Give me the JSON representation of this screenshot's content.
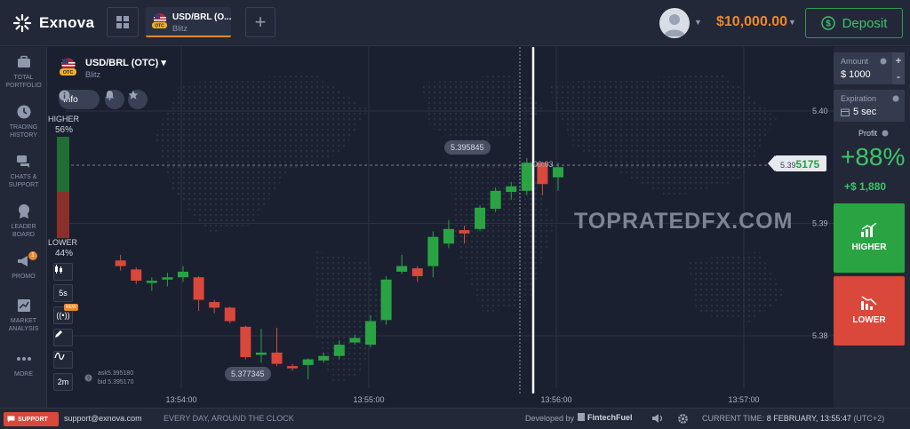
{
  "app": {
    "name": "Exnova"
  },
  "header": {
    "tab": {
      "name": "USD/BRL (O...",
      "sub": "Blitz"
    },
    "balance": "$10,000.00",
    "deposit_label": "Deposit"
  },
  "sidebar": {
    "items": [
      {
        "label": "TOTAL PORTFOLIO",
        "icon": "briefcase-icon"
      },
      {
        "label": "TRADING HISTORY",
        "icon": "clock-icon"
      },
      {
        "label": "CHATS & SUPPORT",
        "icon": "chat-icon"
      },
      {
        "label": "LEADER BOARD",
        "icon": "medal-icon"
      },
      {
        "label": "PROMO",
        "icon": "megaphone-icon",
        "badge": "1"
      },
      {
        "label": "MARKET ANALYSIS",
        "icon": "analysis-icon"
      },
      {
        "label": "MORE",
        "icon": "more-icon"
      }
    ]
  },
  "chart_header": {
    "asset": "USD/BRL (OTC)",
    "type": "Blitz",
    "otc_badge": "OTC",
    "info_label": "Info"
  },
  "sentiment": {
    "higher_label": "HIGHER",
    "higher_pct": "56%",
    "lower_label": "LOWER",
    "lower_pct": "44%"
  },
  "tools": {
    "timeframe": "5s",
    "new_badge": "NEW",
    "interval": "2m"
  },
  "quotes": {
    "ask": "ask5.395180",
    "bid": "bid 5.395170"
  },
  "watermark": "TOPRATEDFX.COM",
  "chart": {
    "high_label": "5.395845",
    "low_label": "5.377345",
    "timer": "00:03",
    "current_price_prefix": "5.39",
    "current_price_suffix": "5175",
    "colors": {
      "up": "#2aa443",
      "down": "#d9483b"
    }
  },
  "chart_data": {
    "type": "candlestick",
    "yticks": [
      5.4,
      5.39,
      5.38
    ],
    "ytick_labels": [
      "5.40",
      "5.39",
      "5.38"
    ],
    "xtick_labels": [
      "13:54:00",
      "13:55:00",
      "13:56:00",
      "13:57:00"
    ],
    "candles": [
      {
        "o": 5.3867,
        "c": 5.3862,
        "h": 5.3872,
        "l": 5.3858
      },
      {
        "o": 5.3859,
        "c": 5.3849,
        "h": 5.3861,
        "l": 5.3846
      },
      {
        "o": 5.3847,
        "c": 5.3849,
        "h": 5.3852,
        "l": 5.384
      },
      {
        "o": 5.385,
        "c": 5.3852,
        "h": 5.3856,
        "l": 5.3844
      },
      {
        "o": 5.3852,
        "c": 5.3857,
        "h": 5.3862,
        "l": 5.3848
      },
      {
        "o": 5.3852,
        "c": 5.3832,
        "h": 5.3853,
        "l": 5.3822
      },
      {
        "o": 5.383,
        "c": 5.3825,
        "h": 5.3832,
        "l": 5.382
      },
      {
        "o": 5.3825,
        "c": 5.3813,
        "h": 5.3826,
        "l": 5.3811
      },
      {
        "o": 5.3808,
        "c": 5.3781,
        "h": 5.3809,
        "l": 5.3779
      },
      {
        "o": 5.3783,
        "c": 5.3785,
        "h": 5.3806,
        "l": 5.3776
      },
      {
        "o": 5.3785,
        "c": 5.3775,
        "h": 5.3807,
        "l": 5.3773
      },
      {
        "o": 5.3773,
        "c": 5.3771,
        "h": 5.3775,
        "l": 5.3769
      },
      {
        "o": 5.3774,
        "c": 5.3779,
        "h": 5.378,
        "l": 5.3761
      },
      {
        "o": 5.3778,
        "c": 5.3782,
        "h": 5.3785,
        "l": 5.3776
      },
      {
        "o": 5.3782,
        "c": 5.3792,
        "h": 5.3796,
        "l": 5.3779
      },
      {
        "o": 5.3794,
        "c": 5.3798,
        "h": 5.3801,
        "l": 5.3792
      },
      {
        "o": 5.3792,
        "c": 5.3813,
        "h": 5.3818,
        "l": 5.379
      },
      {
        "o": 5.3814,
        "c": 5.385,
        "h": 5.3853,
        "l": 5.381
      },
      {
        "o": 5.3857,
        "c": 5.3862,
        "h": 5.3872,
        "l": 5.3855
      },
      {
        "o": 5.386,
        "c": 5.3853,
        "h": 5.3862,
        "l": 5.3848
      },
      {
        "o": 5.3862,
        "c": 5.3888,
        "h": 5.3893,
        "l": 5.3852
      },
      {
        "o": 5.3882,
        "c": 5.3895,
        "h": 5.3903,
        "l": 5.3878
      },
      {
        "o": 5.3894,
        "c": 5.3891,
        "h": 5.3898,
        "l": 5.3882
      },
      {
        "o": 5.3895,
        "c": 5.3914,
        "h": 5.3916,
        "l": 5.3893
      },
      {
        "o": 5.3913,
        "c": 5.3929,
        "h": 5.3932,
        "l": 5.391
      },
      {
        "o": 5.3928,
        "c": 5.3933,
        "h": 5.3937,
        "l": 5.3921
      },
      {
        "o": 5.3929,
        "c": 5.3954,
        "h": 5.3958,
        "l": 5.3925
      },
      {
        "o": 5.3954,
        "c": 5.3935,
        "h": 5.3955,
        "l": 5.3925
      },
      {
        "o": 5.3941,
        "c": 5.395,
        "h": 5.3954,
        "l": 5.3929
      }
    ]
  },
  "rpanel": {
    "amount_label": "Amount",
    "amount_value": "$ 1000",
    "expiration_label": "Expiration",
    "expiration_value": "5 sec",
    "profit_label": "Profit",
    "profit_pct": "+88%",
    "profit_amount": "+$ 1,880",
    "higher_label": "HIGHER",
    "lower_label": "LOWER",
    "plus": "+",
    "minus": "-"
  },
  "footer": {
    "support_label": "SUPPORT",
    "email": "support@exnova.com",
    "hours": "EVERY DAY, AROUND THE CLOCK",
    "developed_by": "Developed by",
    "developer": "FintechFuel",
    "time_label": "CURRENT TIME:",
    "time_value": "8 FEBRUARY, 13:55:47",
    "timezone": "(UTC+2)"
  }
}
